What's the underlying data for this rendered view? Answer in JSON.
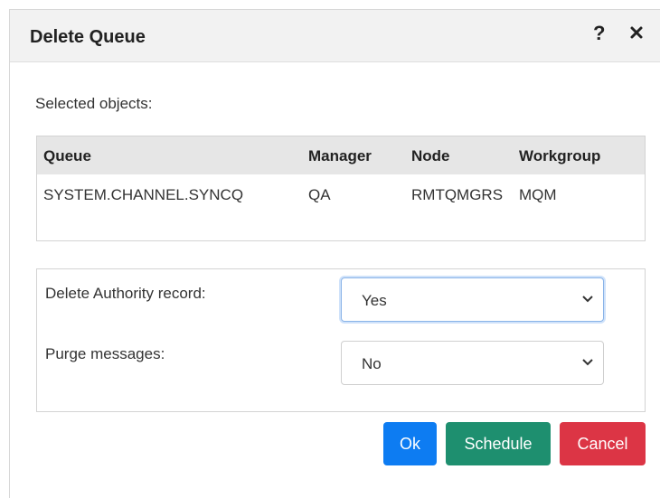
{
  "dialog": {
    "title": "Delete Queue",
    "help_icon": "?",
    "close_icon": "close-icon"
  },
  "selected_objects": {
    "label": "Selected objects:",
    "columns": [
      "Queue",
      "Manager",
      "Node",
      "Workgroup"
    ],
    "rows": [
      [
        "SYSTEM.CHANNEL.SYNCQ",
        "QA",
        "RMTQMGRS",
        "MQM"
      ]
    ]
  },
  "options": {
    "delete_authority": {
      "label": "Delete Authority record:",
      "value": "Yes"
    },
    "purge_messages": {
      "label": "Purge messages:",
      "value": "No"
    }
  },
  "buttons": {
    "ok": "Ok",
    "schedule": "Schedule",
    "cancel": "Cancel"
  },
  "colors": {
    "ok": "#0d7cf2",
    "schedule": "#1e8f6f",
    "cancel": "#dc3545",
    "header_bg": "#f2f2f2",
    "table_header_bg": "#e6e6e6"
  }
}
